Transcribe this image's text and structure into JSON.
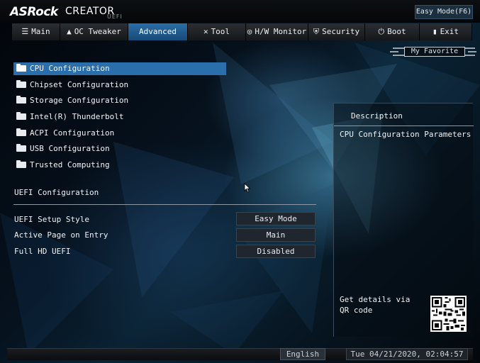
{
  "brand": {
    "name": "ASRock",
    "product": "CREATOR",
    "sub": "UEFI"
  },
  "easy_mode_button": "Easy Mode(F6)",
  "tabs": [
    {
      "label": "Main",
      "icon": "list-icon",
      "active": false
    },
    {
      "label": "OC Tweaker",
      "icon": "rocket-icon",
      "active": false
    },
    {
      "label": "Advanced",
      "icon": "",
      "active": true
    },
    {
      "label": "Tool",
      "icon": "tools-icon",
      "active": false
    },
    {
      "label": "H/W Monitor",
      "icon": "monitor-gauge-icon",
      "active": false
    },
    {
      "label": "Security",
      "icon": "shield-icon",
      "active": false
    },
    {
      "label": "Boot",
      "icon": "power-icon",
      "active": false
    },
    {
      "label": "Exit",
      "icon": "door-icon",
      "active": false
    }
  ],
  "favorite": "My Favorite",
  "menu": [
    {
      "label": "CPU Configuration",
      "selected": true
    },
    {
      "label": "Chipset Configuration",
      "selected": false
    },
    {
      "label": "Storage Configuration",
      "selected": false
    },
    {
      "label": "Intel(R) Thunderbolt",
      "selected": false
    },
    {
      "label": "ACPI Configuration",
      "selected": false
    },
    {
      "label": "USB Configuration",
      "selected": false
    },
    {
      "label": "Trusted Computing",
      "selected": false
    }
  ],
  "uefi_section": {
    "title": "UEFI Configuration",
    "settings": [
      {
        "label": "UEFI Setup Style",
        "value": "Easy Mode"
      },
      {
        "label": "Active Page on Entry",
        "value": "Main"
      },
      {
        "label": "Full HD UEFI",
        "value": "Disabled"
      }
    ]
  },
  "description": {
    "title": "Description",
    "text": "CPU Configuration Parameters",
    "qr_text": "Get details via QR code"
  },
  "footer": {
    "language": "English",
    "datetime": "Tue 04/21/2020, 02:04:57"
  },
  "colors": {
    "accent": "#2a6fab",
    "background": "#06121e"
  }
}
